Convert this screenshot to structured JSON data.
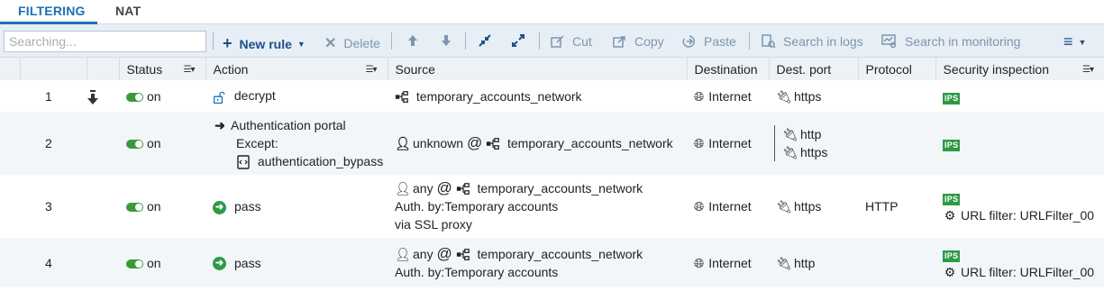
{
  "tabs": [
    {
      "label": "FILTERING",
      "active": true
    },
    {
      "label": "NAT",
      "active": false
    }
  ],
  "toolbar": {
    "search_placeholder": "Searching...",
    "new_rule": "New rule",
    "delete": "Delete",
    "cut": "Cut",
    "copy": "Copy",
    "paste": "Paste",
    "search_logs": "Search in logs",
    "search_monitoring": "Search in monitoring"
  },
  "columns": [
    "Status",
    "Action",
    "Source",
    "Destination",
    "Dest. port",
    "Protocol",
    "Security inspection"
  ],
  "rows": [
    {
      "num": "1",
      "status": "on",
      "action": "decrypt",
      "source_network": "temporary_accounts_network",
      "destination": "Internet",
      "ports": [
        "https"
      ],
      "protocol": "",
      "ips": "IPS"
    },
    {
      "num": "2",
      "status": "on",
      "action": "Authentication portal",
      "action_except": "Except:",
      "action_except_item": "authentication_bypass",
      "source_user": "unknown",
      "source_at": "@",
      "source_network": "temporary_accounts_network",
      "destination": "Internet",
      "ports": [
        "http",
        "https"
      ],
      "protocol": "",
      "ips": "IPS"
    },
    {
      "num": "3",
      "status": "on",
      "action": "pass",
      "source_user": "any",
      "source_at": "@",
      "source_network": "temporary_accounts_network",
      "source_auth": "Auth. by:Temporary accounts",
      "source_via": "via SSL proxy",
      "destination": "Internet",
      "ports": [
        "https"
      ],
      "protocol": "HTTP",
      "ips": "IPS",
      "url_filter": "URL filter: URLFilter_00"
    },
    {
      "num": "4",
      "status": "on",
      "action": "pass",
      "source_user": "any",
      "source_at": "@",
      "source_network": "temporary_accounts_network",
      "source_auth": "Auth. by:Temporary accounts",
      "destination": "Internet",
      "ports": [
        "http"
      ],
      "protocol": "",
      "ips": "IPS",
      "url_filter": "URL filter: URLFilter_00"
    }
  ],
  "colors": {
    "accent": "#1d6fb8",
    "toggle_on": "#3a9a3a",
    "ips_badge": "#2f9a46"
  }
}
